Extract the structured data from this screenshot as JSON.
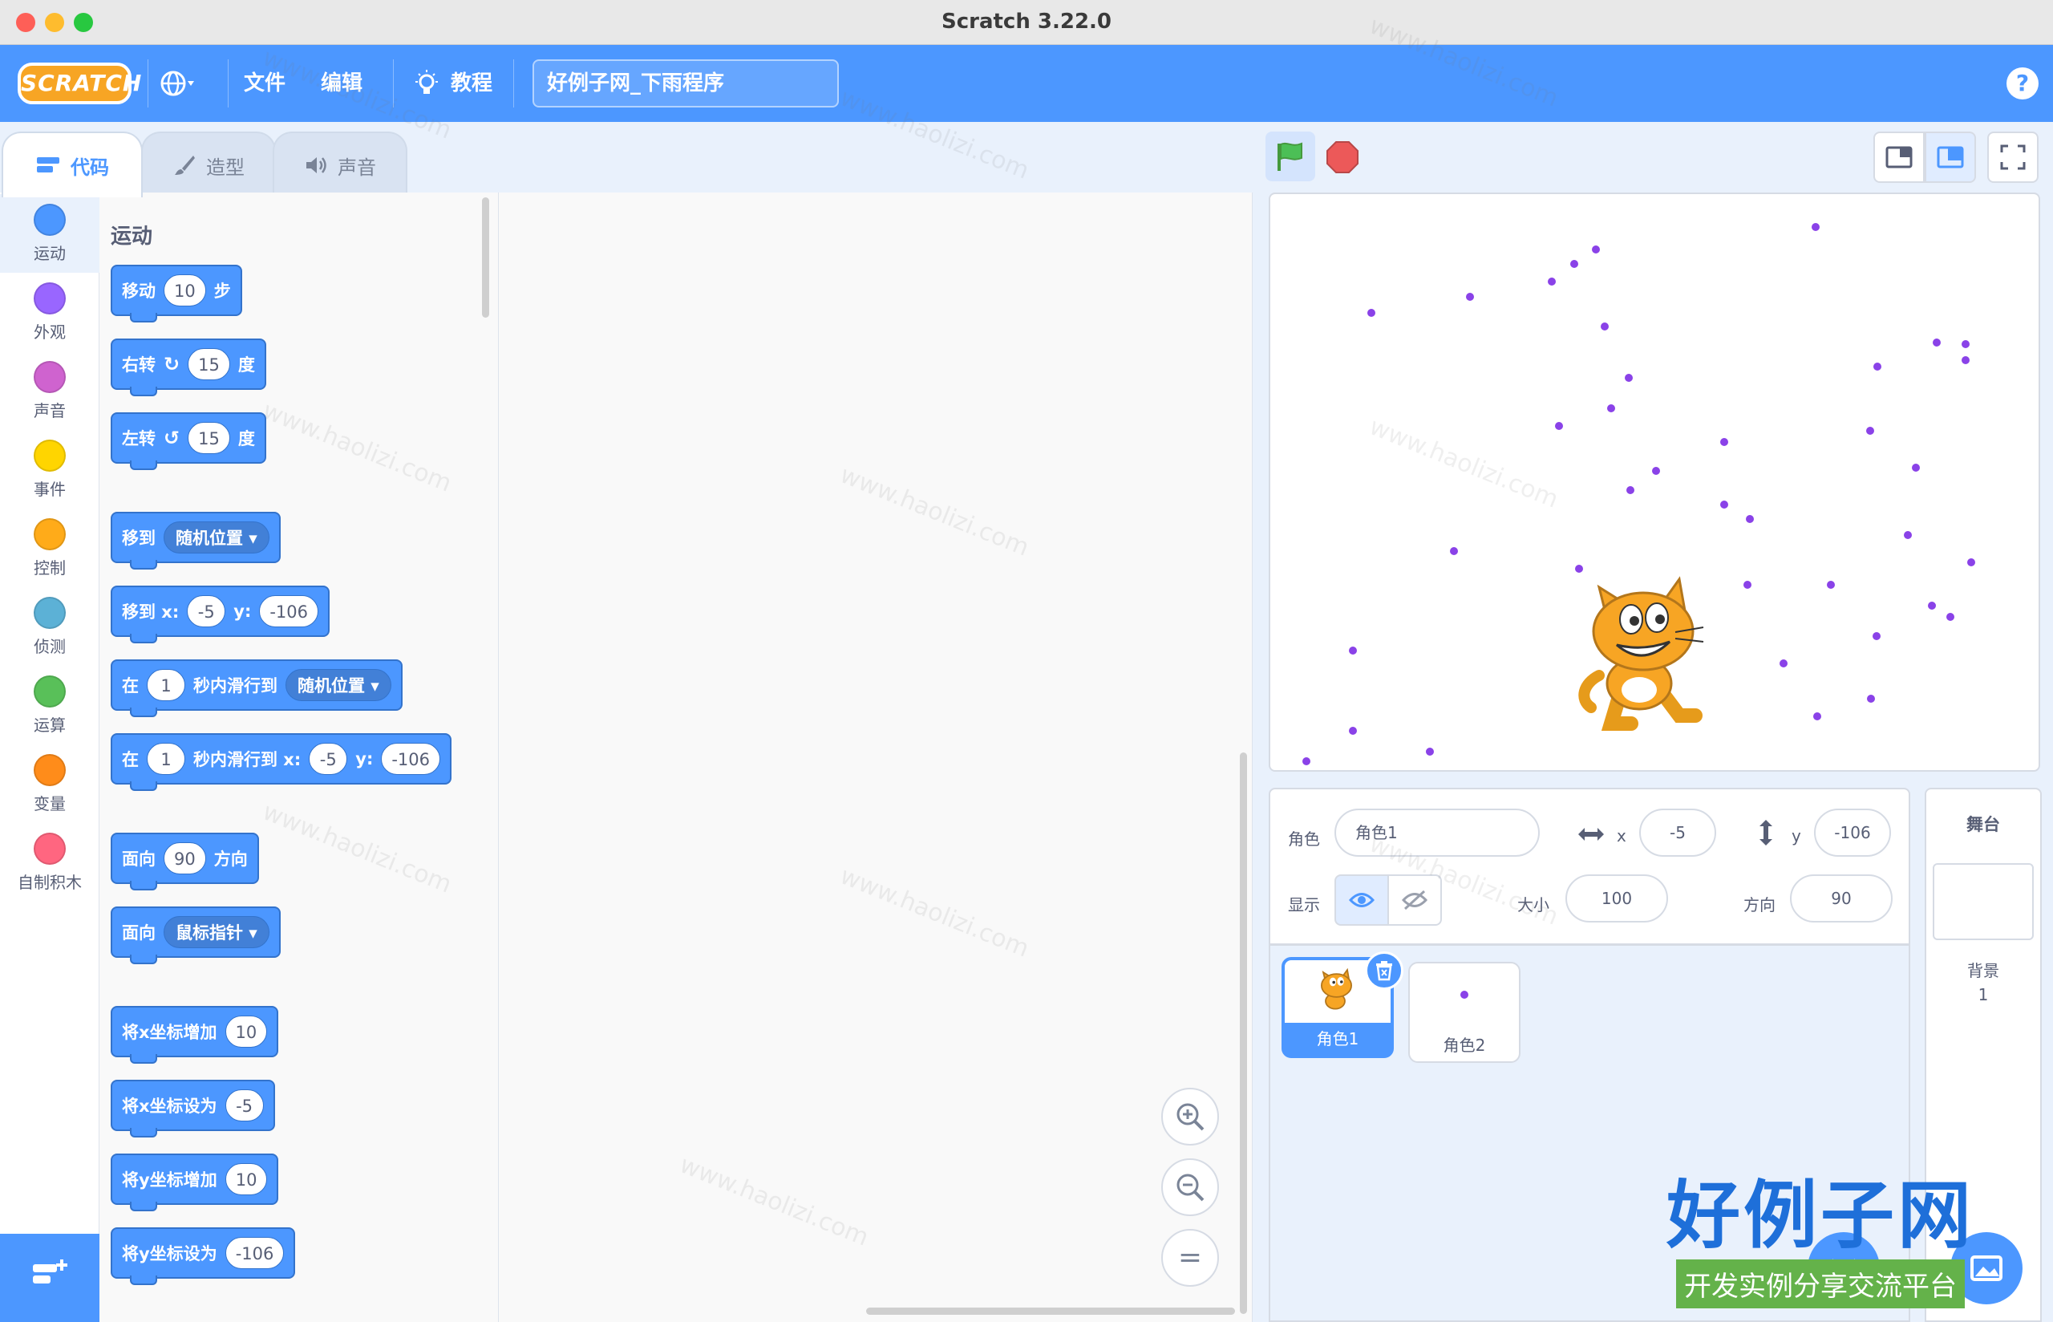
{
  "window": {
    "title": "Scratch 3.22.0"
  },
  "menubar": {
    "logo_text": "SCRATCH",
    "file": "文件",
    "edit": "编辑",
    "tutorials": "教程",
    "project_title": "好例子网_下雨程序",
    "help": "?"
  },
  "tabs": [
    {
      "label": "代码",
      "icon": "code-icon",
      "active": true
    },
    {
      "label": "造型",
      "icon": "brush-icon",
      "active": false
    },
    {
      "label": "声音",
      "icon": "speaker-icon",
      "active": false
    }
  ],
  "categories": [
    {
      "label": "运动",
      "color": "#4c97ff"
    },
    {
      "label": "外观",
      "color": "#9966ff"
    },
    {
      "label": "声音",
      "color": "#cf63cf"
    },
    {
      "label": "事件",
      "color": "#ffd500"
    },
    {
      "label": "控制",
      "color": "#ffab19"
    },
    {
      "label": "侦测",
      "color": "#5cb1d6"
    },
    {
      "label": "运算",
      "color": "#59c059"
    },
    {
      "label": "变量",
      "color": "#ff8c1a"
    },
    {
      "label": "自制积木",
      "color": "#ff6680"
    }
  ],
  "palette": {
    "heading": "运动",
    "blocks": {
      "move": {
        "label": "移动",
        "value": "10",
        "suffix": "步"
      },
      "turn_right": {
        "label": "右转",
        "value": "15",
        "suffix": "度"
      },
      "turn_left": {
        "label": "左转",
        "value": "15",
        "suffix": "度"
      },
      "goto": {
        "label": "移到",
        "dropdown": "随机位置"
      },
      "goto_xy": {
        "label": "移到 x:",
        "x": "-5",
        "ylabel": "y:",
        "y": "-106"
      },
      "glide": {
        "label": "在",
        "secs": "1",
        "mid": "秒内滑行到",
        "dropdown": "随机位置"
      },
      "glide_xy": {
        "label": "在",
        "secs": "1",
        "mid": "秒内滑行到 x:",
        "x": "-5",
        "ylabel": "y:",
        "y": "-106"
      },
      "point_dir": {
        "label": "面向",
        "value": "90",
        "suffix": "方向"
      },
      "point_towards": {
        "label": "面向",
        "dropdown": "鼠标指针"
      },
      "change_x": {
        "label": "将x坐标增加",
        "value": "10"
      },
      "set_x": {
        "label": "将x坐标设为",
        "value": "-5"
      },
      "change_y": {
        "label": "将y坐标增加",
        "value": "10"
      },
      "set_y": {
        "label": "将y坐标设为",
        "value": "-106"
      }
    }
  },
  "zoom": {
    "in": "+",
    "out": "−",
    "reset": "="
  },
  "sprite_info": {
    "sprite_label": "角色",
    "sprite_name": "角色1",
    "x_label": "x",
    "x": "-5",
    "y_label": "y",
    "y": "-106",
    "show_label": "显示",
    "size_label": "大小",
    "size": "100",
    "direction_label": "方向",
    "direction": "90"
  },
  "sprites": [
    {
      "name": "角色1",
      "selected": true
    },
    {
      "name": "角色2",
      "selected": false
    }
  ],
  "stage_panel": {
    "title": "舞台",
    "backdrop_label": "背景",
    "backdrop_count": "1"
  },
  "watermark": {
    "text": "www.haolizi.com",
    "logo": "好例子网",
    "slogan": "开发实例分享交流平台"
  },
  "colors": {
    "accent": "#4c97ff",
    "raindrop": "#8a42e8"
  }
}
